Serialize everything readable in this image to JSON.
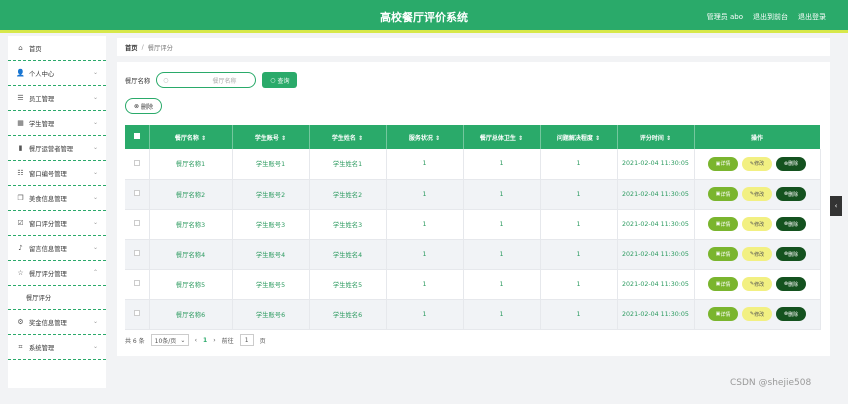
{
  "header": {
    "title": "高校餐厅评价系统",
    "user": "管理员 abo",
    "back_frontend": "退出到前台",
    "logout": "退出登录"
  },
  "sidebar": {
    "items": [
      {
        "label": "首页",
        "icon": "home-icon",
        "glyph": "⌂"
      },
      {
        "label": "个人中心",
        "icon": "user-icon",
        "glyph": "👤"
      },
      {
        "label": "员工管理",
        "icon": "list-icon",
        "glyph": "☰"
      },
      {
        "label": "学生管理",
        "icon": "grid-icon",
        "glyph": "▦"
      },
      {
        "label": "餐厅运营者管理",
        "icon": "chart-icon",
        "glyph": "▮"
      },
      {
        "label": "窗口编号管理",
        "icon": "sliders-icon",
        "glyph": "☷"
      },
      {
        "label": "美食信息管理",
        "icon": "copy-icon",
        "glyph": "❐"
      },
      {
        "label": "窗口评分管理",
        "icon": "edit-box-icon",
        "glyph": "☑"
      },
      {
        "label": "留言信息管理",
        "icon": "mic-icon",
        "glyph": "♪"
      },
      {
        "label": "餐厅评分管理",
        "icon": "star-icon",
        "glyph": "☆"
      }
    ],
    "submenu_label": "餐厅评分",
    "items_after": [
      {
        "label": "奖金信息管理",
        "icon": "gear-icon",
        "glyph": "⚙"
      },
      {
        "label": "系统管理",
        "icon": "crop-icon",
        "glyph": "⌗"
      }
    ]
  },
  "breadcrumb": {
    "home": "首页",
    "separator": "/",
    "current": "餐厅评分"
  },
  "search": {
    "label": "餐厅名称",
    "placeholder": "餐厅名称",
    "button": "查询",
    "delete_button": "删除"
  },
  "table": {
    "columns": [
      "餐厅名称",
      "学生账号",
      "学生姓名",
      "服务状况",
      "餐厅总体卫生",
      "问题解决程度",
      "评分时间",
      "操作"
    ],
    "rows": [
      {
        "name": "餐厅名称1",
        "account": "学生账号1",
        "student": "学生姓名1",
        "service": "1",
        "hygiene": "1",
        "solve": "1",
        "time": "2021-02-04 11:30:05"
      },
      {
        "name": "餐厅名称2",
        "account": "学生账号2",
        "student": "学生姓名2",
        "service": "1",
        "hygiene": "1",
        "solve": "1",
        "time": "2021-02-04 11:30:05"
      },
      {
        "name": "餐厅名称3",
        "account": "学生账号3",
        "student": "学生姓名3",
        "service": "1",
        "hygiene": "1",
        "solve": "1",
        "time": "2021-02-04 11:30:05"
      },
      {
        "name": "餐厅名称4",
        "account": "学生账号4",
        "student": "学生姓名4",
        "service": "1",
        "hygiene": "1",
        "solve": "1",
        "time": "2021-02-04 11:30:05"
      },
      {
        "name": "餐厅名称5",
        "account": "学生账号5",
        "student": "学生姓名5",
        "service": "1",
        "hygiene": "1",
        "solve": "1",
        "time": "2021-02-04 11:30:05"
      },
      {
        "name": "餐厅名称6",
        "account": "学生账号6",
        "student": "学生姓名6",
        "service": "1",
        "hygiene": "1",
        "solve": "1",
        "time": "2021-02-04 11:30:05"
      }
    ],
    "ops": {
      "view": "详情",
      "edit": "修改",
      "delete": "删除"
    }
  },
  "pager": {
    "total": "共 6 条",
    "page_size": "10条/页",
    "prev": "‹",
    "current": "1",
    "next": "›",
    "goto": "前往",
    "goto_value": "1",
    "page_suffix": "页"
  },
  "watermark": "CSDN @shejie508",
  "colors": {
    "primary": "#2aaa6a",
    "accent_bar": "#d7e84a",
    "view_btn": "#7ab52e",
    "edit_btn": "#f2f082",
    "delete_btn": "#14521f"
  }
}
